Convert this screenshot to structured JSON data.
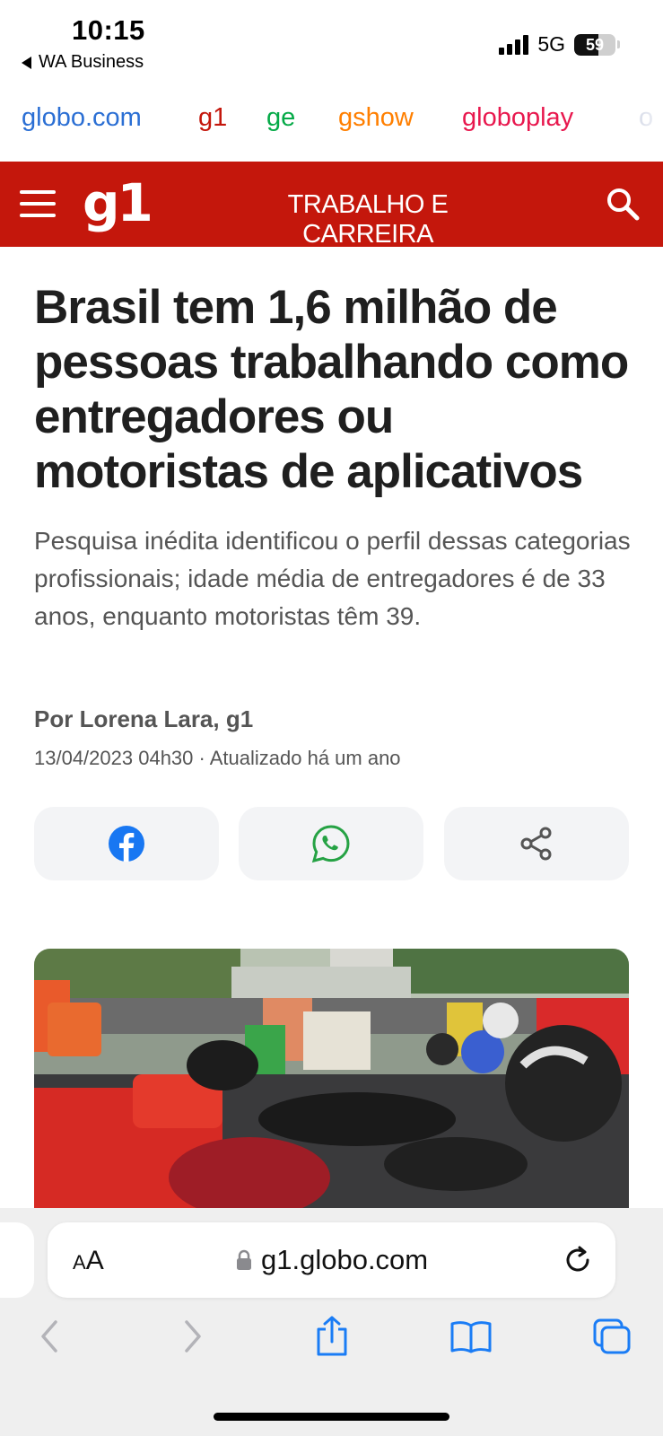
{
  "status_bar": {
    "time": "10:15",
    "back_app": "WA Business",
    "network": "5G",
    "battery_level": "59",
    "battery_fraction": 0.59
  },
  "portal_nav": {
    "items": [
      {
        "label": "globo.com",
        "color": "#2b6fd4"
      },
      {
        "label": "g1",
        "color": "#c4170c"
      },
      {
        "label": "ge",
        "color": "#06aa48"
      },
      {
        "label": "gshow",
        "color": "#ff7f00"
      },
      {
        "label": "globoplay",
        "color": "#e8184e"
      },
      {
        "label": "o",
        "color": "#b7bfd6"
      }
    ]
  },
  "header": {
    "logo": "g1",
    "section": "TRABALHO E CARREIRA",
    "menu_icon": "hamburger-icon",
    "search_icon": "search-icon",
    "brand_color": "#c4170c"
  },
  "article": {
    "headline": "Brasil tem 1,6 milhão de pessoas trabalhando como entregadores ou motoristas de aplicativos",
    "subheadline": "Pesquisa inédita identificou o perfil dessas categorias profissionais; idade média de entregadores é de 33 anos, enquanto motoristas têm 39.",
    "byline": "Por Lorena Lara, g1",
    "date": "13/04/2023 04h30 · Atualizado há um ano"
  },
  "share_buttons": [
    {
      "icon": "facebook-icon",
      "color": "#1877f2"
    },
    {
      "icon": "whatsapp-icon",
      "color": "#25a244"
    },
    {
      "icon": "share-icon",
      "color": "#555555"
    }
  ],
  "browser": {
    "text_size_label": "AA",
    "url": "g1.globo.com",
    "lock_icon": "lock-icon",
    "reload_icon": "reload-icon",
    "toolbar_icons": [
      "back-icon",
      "forward-icon",
      "share-icon",
      "bookmarks-icon",
      "tabs-icon"
    ],
    "accent": "#1a7cf5"
  }
}
